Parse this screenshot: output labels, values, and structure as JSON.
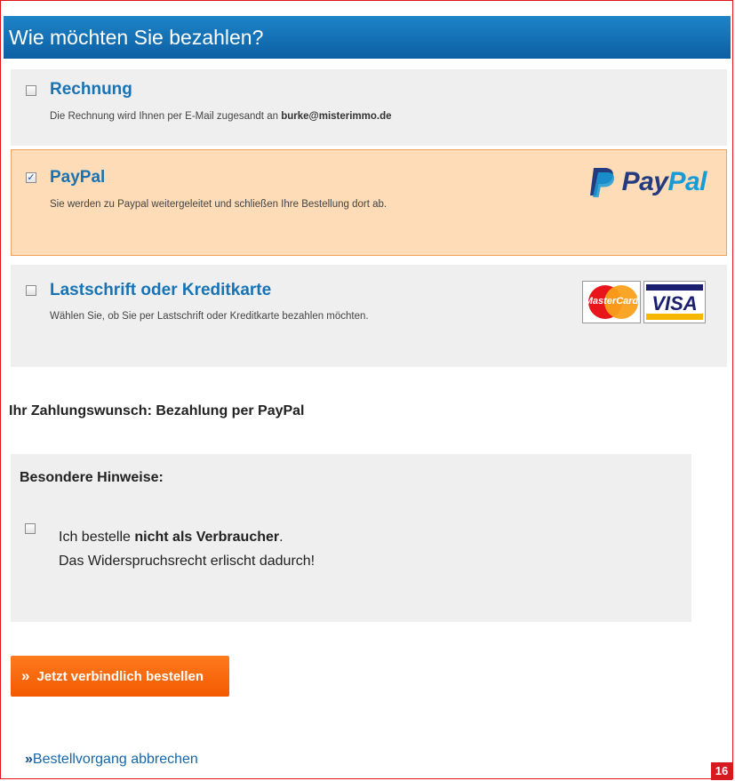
{
  "header": {
    "title": "Wie möchten Sie bezahlen?"
  },
  "options": [
    {
      "title": "Rechnung",
      "desc_prefix": "Die Rechnung wird Ihnen per E-Mail zugesandt an ",
      "email": "burke@misterimmo.de",
      "checked": false
    },
    {
      "title": "PayPal",
      "desc": "Sie werden zu Paypal weitergeleitet und schließen Ihre Bestellung dort ab.",
      "logo_text_a": "Pay",
      "logo_text_b": "Pal",
      "checked": true
    },
    {
      "title": "Lastschrift oder Kreditkarte",
      "desc": "Wählen Sie, ob Sie per Lastschrift oder Kreditkarte bezahlen möchten.",
      "card_mastercard": "MasterCard",
      "card_visa": "VISA",
      "checked": false
    }
  ],
  "payment_wish": "Ihr Zahlungswunsch: Bezahlung per PayPal",
  "notes": {
    "title": "Besondere Hinweise:",
    "line1_prefix": "Ich bestelle ",
    "line1_bold": "nicht als Verbraucher",
    "line1_suffix": ".",
    "line2": "Das Widerspruchsrecht erlischt dadurch!",
    "checked": false
  },
  "order_button": {
    "arrow": "»",
    "label": "Jetzt verbindlich bestellen"
  },
  "cancel_link": {
    "arrow": "»",
    "label": "Bestellvorgang abbrechen"
  },
  "page_number": "16",
  "colors": {
    "accent_blue": "#1873b5",
    "selected_bg": "#fddcb7",
    "button_orange": "#f35a00",
    "frame_red": "#e2131a"
  }
}
